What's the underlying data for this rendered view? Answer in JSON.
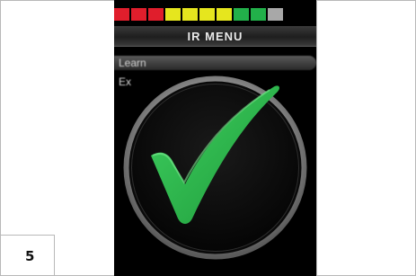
{
  "step": {
    "number": "5"
  },
  "screen": {
    "battery_segments": [
      "#e01e2c",
      "#e01e2c",
      "#e01e2c",
      "#e6e61e",
      "#e6e61e",
      "#e6e61e",
      "#e6e61e",
      "#22b04a",
      "#22b04a",
      "#a8a8a8"
    ],
    "menu_title": "IR MENU",
    "menu_items": [
      {
        "label": "Learn"
      },
      {
        "label": "Ex"
      }
    ],
    "confirmation": {
      "icon": "checkmark-icon",
      "accent": "#28b84a"
    }
  }
}
